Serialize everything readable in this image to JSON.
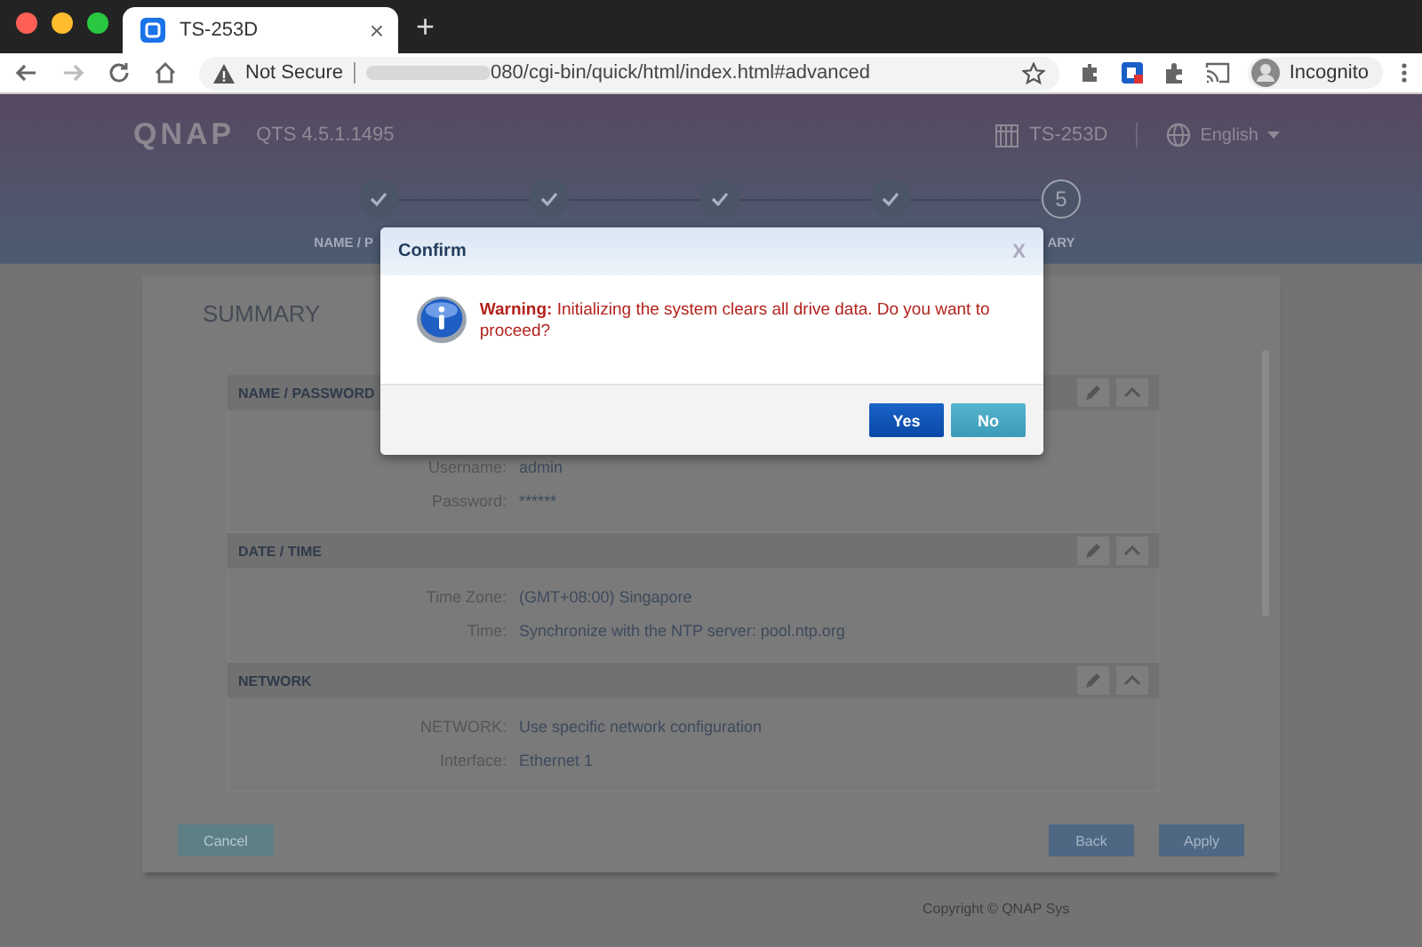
{
  "browser": {
    "tab": {
      "title": "TS-253D",
      "close": "×"
    },
    "new_tab": "+",
    "address": {
      "security": "Not Secure",
      "url": "080/cgi-bin/quick/html/index.html#advanced"
    },
    "profile": "Incognito"
  },
  "header": {
    "logo": "QNAP",
    "version": "QTS 4.5.1.1495",
    "device": "TS-253D",
    "language": "English"
  },
  "steps": [
    {
      "kind": "done",
      "label": "NAME / P"
    },
    {
      "kind": "done"
    },
    {
      "kind": "done"
    },
    {
      "kind": "done"
    },
    {
      "kind": "current",
      "number": "5",
      "label": "ARY"
    }
  ],
  "summary": {
    "title": "SUMMARY",
    "sections": [
      {
        "title": "NAME / PASSWORD",
        "rows": [
          {
            "label": "Username:",
            "value": "admin"
          },
          {
            "label": "Password:",
            "value": "******"
          }
        ]
      },
      {
        "title": "DATE / TIME",
        "rows": [
          {
            "label": "Time Zone:",
            "value": "(GMT+08:00) Singapore"
          },
          {
            "label": "Time:",
            "value": "Synchronize with the NTP server: pool.ntp.org"
          }
        ]
      },
      {
        "title": "NETWORK",
        "rows": [
          {
            "label": "NETWORK:",
            "value": "Use specific network configuration"
          },
          {
            "label": "Interface:",
            "value": "Ethernet 1"
          }
        ]
      }
    ]
  },
  "footer": {
    "cancel": "Cancel",
    "back": "Back",
    "apply": "Apply",
    "copyright": "Copyright © QNAP Sys"
  },
  "dialog": {
    "title": "Confirm",
    "close": "X",
    "message": "**Warning:** Initializing the system clears all drive data. Do you want to proceed?",
    "buttons": [
      {
        "label": "Yes",
        "kind": "primary"
      },
      {
        "label": "No",
        "kind": "secondary"
      }
    ]
  }
}
